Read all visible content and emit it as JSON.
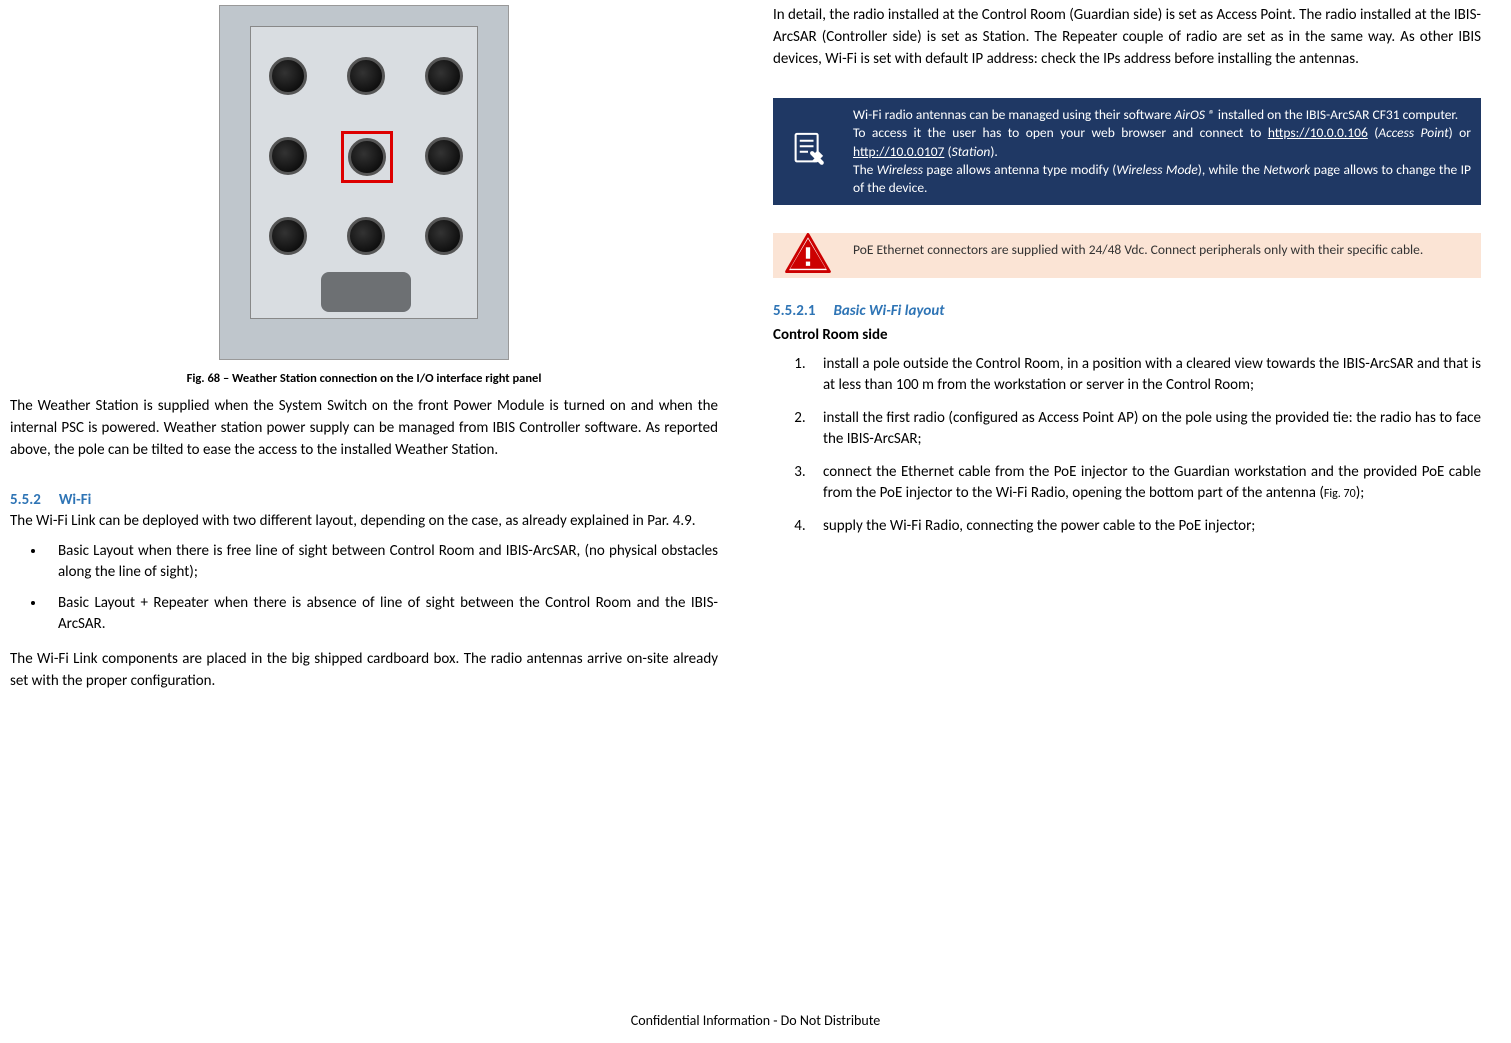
{
  "left": {
    "fig_caption": "Fig. 68 – Weather Station connection on the I/O interface right panel",
    "para1": "The Weather Station is supplied when the System Switch on the front Power Module is turned on and when the internal PSC is powered. Weather station power supply can be managed from IBIS Controller software. As reported above, the pole can be tilted to ease the access to the installed Weather Station.",
    "h552_num": "5.5.2",
    "h552_title": "Wi-Fi",
    "para2": "The Wi-Fi Link can be deployed with two different layout, depending on the case, as already explained in Par. 4.9.",
    "bullet1": "Basic Layout when there is free line of sight between Control Room and IBIS-ArcSAR, (no physical obstacles along the line of sight);",
    "bullet2": "Basic Layout + Repeater when there is absence of line of sight between the Control Room and the IBIS-ArcSAR.",
    "para3": "The Wi-Fi Link components are placed in the big shipped cardboard box. The radio antennas arrive on-site already set with the proper configuration."
  },
  "right": {
    "para1": "In detail, the radio installed at the Control Room (Guardian side) is set as Access Point. The radio installed at the IBIS-ArcSAR (Controller side) is set as Station. The Repeater couple of radio are set as in the same way. As other IBIS devices, Wi-Fi is set with default IP address: check the IPs address before installing the antennas.",
    "note_a_pre": "Wi-Fi radio antennas can be managed using their software ",
    "note_a_air": "AirOS ®",
    "note_a_post1": " installed on the IBIS-ArcSAR CF31 computer.",
    "note_a_line2_pre": "To access it the user has to open your web browser and connect to ",
    "note_a_url1": "https://10.0.0.106",
    "note_a_mid1": " (",
    "note_a_ap": "Access Point",
    "note_a_mid2": ") or ",
    "note_a_url2": "http://10.0.0107",
    "note_a_mid3": " (",
    "note_a_st": "Station",
    "note_a_end": ").",
    "note_a_line3_pre": "The ",
    "note_a_wireless": "Wireless",
    "note_a_line3_mid": " page allows antenna type modify (",
    "note_a_wmode": "Wireless Mode",
    "note_a_line3_mid2": "), while the ",
    "note_a_network": "Network",
    "note_a_line3_end": " page allows to change the IP of the device.",
    "note_b": "PoE Ethernet connectors are supplied with 24/48 Vdc. Connect peripherals only with their specific cable.",
    "h5521_num": "5.5.2.1",
    "h5521_title": "Basic Wi-Fi layout",
    "h_control": "Control Room side",
    "step1": "install a pole outside the Control Room, in a position with a cleared view towards the IBIS-ArcSAR and that is at less than 100 m from the workstation or server in the Control Room;",
    "step2": "install the first radio (configured as Access Point AP) on the pole using the provided tie: the radio has to face the IBIS-ArcSAR;",
    "step3_pre": "connect the Ethernet cable from the PoE injector to the Guardian workstation and the provided PoE cable from the PoE injector to the Wi-Fi Radio, opening the bottom part of the antenna (",
    "step3_fig": "Fig. 70",
    "step3_post": ");",
    "step4": "supply the Wi-Fi Radio, connecting the power cable to the PoE injector;"
  },
  "footer": "Confidential Information - Do Not Distribute"
}
